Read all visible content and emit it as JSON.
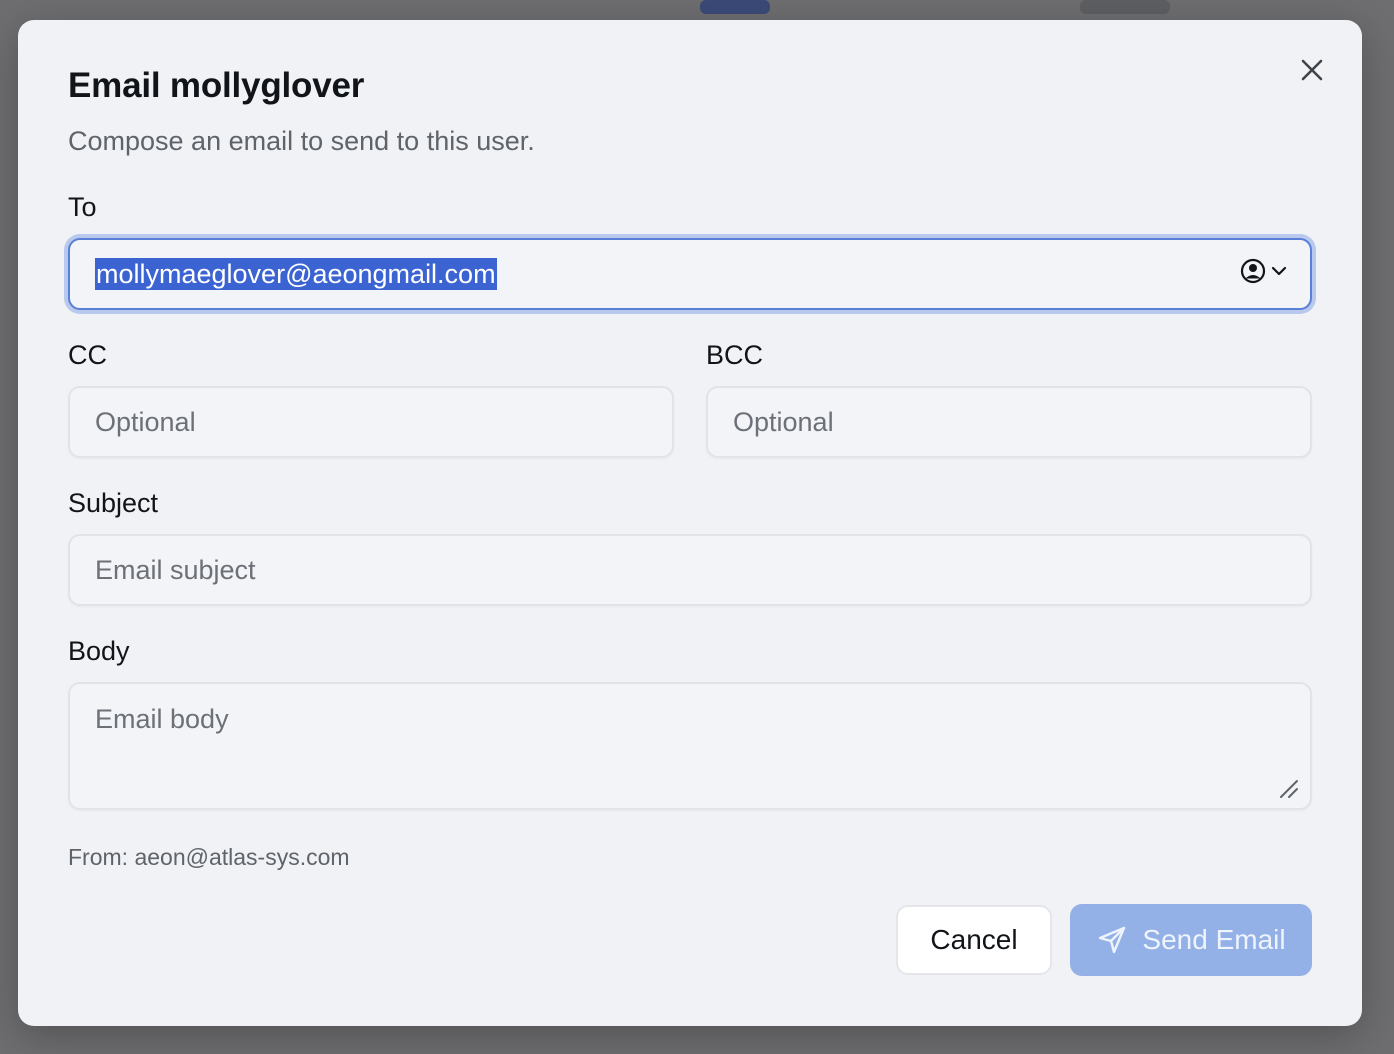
{
  "dialog": {
    "title": "Email mollyglover",
    "subtitle": "Compose an email to send to this user."
  },
  "to": {
    "label": "To",
    "value": "mollymaeglover@aeongmail.com"
  },
  "cc": {
    "label": "CC",
    "placeholder": "Optional"
  },
  "bcc": {
    "label": "BCC",
    "placeholder": "Optional"
  },
  "subject": {
    "label": "Subject",
    "placeholder": "Email subject"
  },
  "body": {
    "label": "Body",
    "placeholder": "Email body"
  },
  "from_text": "From: aeon@atlas-sys.com",
  "buttons": {
    "cancel": "Cancel",
    "send": "Send Email"
  },
  "icons": {
    "close": "close-icon",
    "contact": "user-circle-icon",
    "chevron": "chevron-down-icon",
    "send": "send-icon",
    "resize": "resize-handle-icon"
  },
  "colors": {
    "focus_ring": "#5a7fd6",
    "selection": "#3b63d1",
    "send_button": "#93b1e6"
  }
}
